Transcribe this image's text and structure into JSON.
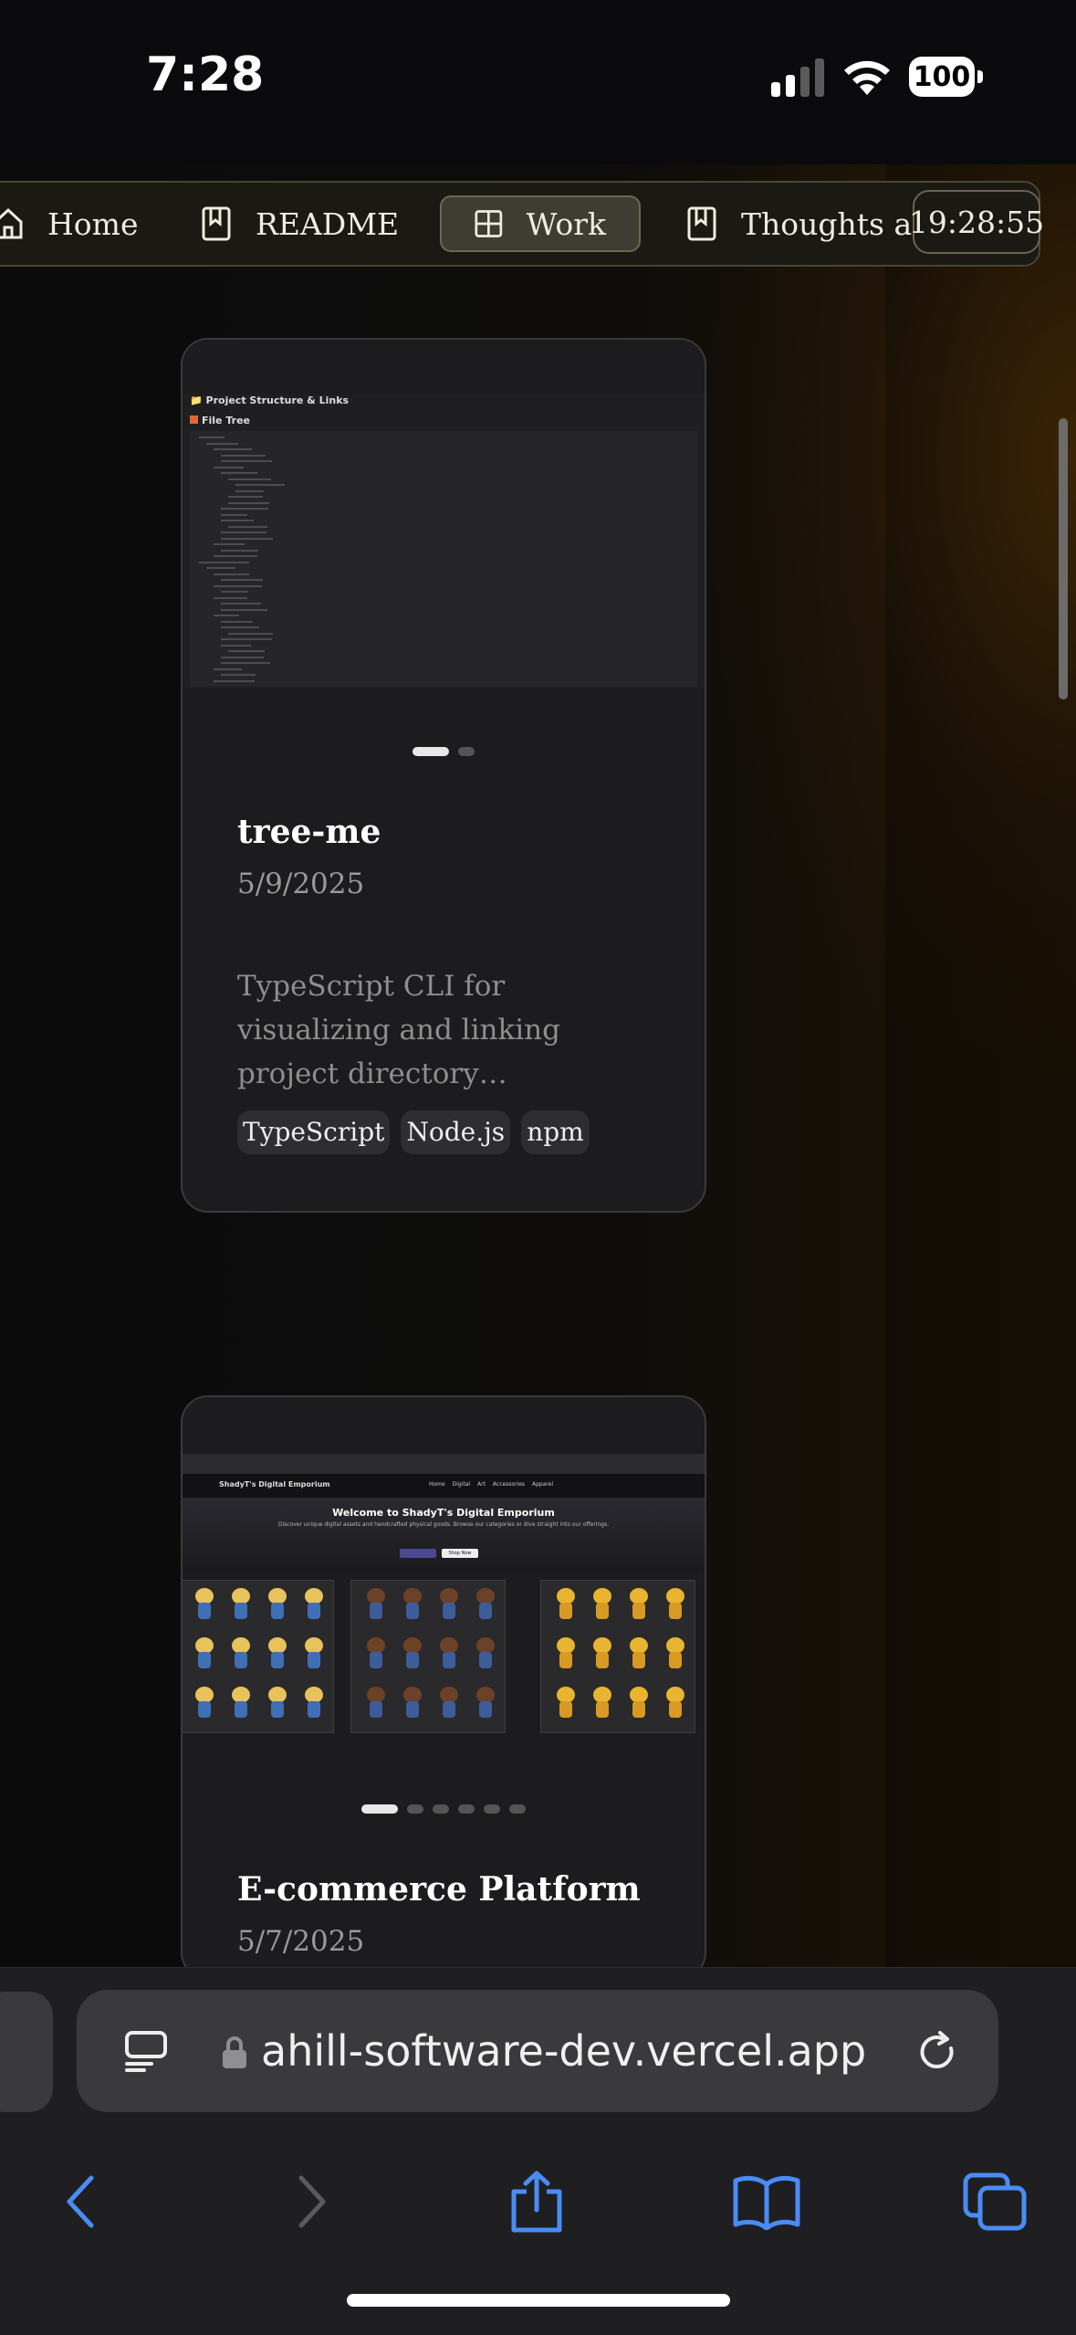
{
  "status_bar": {
    "time": "7:28",
    "battery": "100"
  },
  "nav": {
    "items": [
      {
        "label": "Home",
        "icon": "home-icon",
        "active": false
      },
      {
        "label": "README",
        "icon": "book-icon",
        "active": false
      },
      {
        "label": "Work",
        "icon": "grid-icon",
        "active": true
      },
      {
        "label": "Thoughts and",
        "icon": "book-icon",
        "active": false
      }
    ],
    "clock": "19:28:55"
  },
  "projects": [
    {
      "title": "tree-me",
      "date": "5/9/2025",
      "description": "TypeScript CLI for visualizing and linking project directory…",
      "tags": [
        "TypeScript",
        "Node.js",
        "npm"
      ],
      "preview": {
        "heading": "📁 Project Structure & Links",
        "subheading": "File Tree"
      },
      "slides": 2,
      "active_slide": 0
    },
    {
      "title": "E-commerce Platform",
      "date": "5/7/2025",
      "preview": {
        "hero_title": "Welcome to ShadyT's Digital Emporium",
        "hero_sub": "Discover unique digital assets and handcrafted physical goods. Browse our categories or dive straight into our offerings.",
        "brand": "ShadyT's Digital Emporium",
        "menu": [
          "Home",
          "Digital",
          "Art",
          "Accessories",
          "Apparel"
        ],
        "button": "Shop Now"
      },
      "slides": 6,
      "active_slide": 0
    }
  ],
  "browser": {
    "url": "ahill-software-dev.vercel.app",
    "toolbar": [
      "back-icon",
      "forward-icon",
      "share-icon",
      "bookmarks-icon",
      "tabs-icon"
    ]
  },
  "colors": {
    "accent": "#4a8cf7",
    "nav_bg": "#1b1913",
    "card_bg": "#1c1c1e"
  }
}
